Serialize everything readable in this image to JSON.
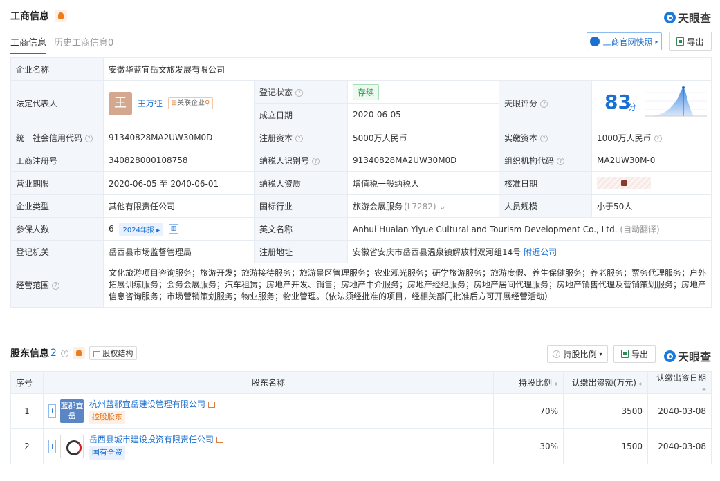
{
  "header": {
    "title": "工商信息",
    "tabs": [
      {
        "label": "工商信息"
      },
      {
        "label": "历史工商信息0"
      }
    ],
    "logo_text": "天眼查",
    "snapshot_btn": "工商官网快照",
    "export_btn": "导出"
  },
  "info": {
    "company_name_label": "企业名称",
    "company_name": "安徽华蓝宜岳文旅发展有限公司",
    "legal_rep_label": "法定代表人",
    "legal_rep_avatar": "王",
    "legal_rep_name": "王万征",
    "legal_rep_tag": "关联企业",
    "reg_status_label": "登记状态",
    "reg_status": "存续",
    "found_date_label": "成立日期",
    "found_date": "2020-06-05",
    "score_label": "天眼评分",
    "score": "83",
    "score_unit": "分",
    "credit_code_label": "统一社会信用代码",
    "credit_code": "91340828MA2UW30M0D",
    "reg_capital_label": "注册资本",
    "reg_capital": "5000万人民币",
    "paid_capital_label": "实缴资本",
    "paid_capital": "1000万人民币",
    "reg_no_label": "工商注册号",
    "reg_no": "340828000108758",
    "taxpayer_id_label": "纳税人识别号",
    "taxpayer_id": "91340828MA2UW30M0D",
    "org_code_label": "组织机构代码",
    "org_code": "MA2UW30M-0",
    "term_label": "营业期限",
    "term": "2020-06-05 至 2040-06-01",
    "taxpayer_qual_label": "纳税人资质",
    "taxpayer_qual": "增值税一般纳税人",
    "approve_date_label": "核准日期",
    "type_label": "企业类型",
    "type": "其他有限责任公司",
    "industry_label": "国标行业",
    "industry": "旅游会展服务",
    "industry_code": "(L7282)",
    "staff_label": "人员规模",
    "staff": "小于50人",
    "insured_label": "参保人数",
    "insured": "6",
    "insured_tag": "2024年报",
    "en_name_label": "英文名称",
    "en_name": "Anhui Hualan Yiyue Cultural and Tourism Development Co., Ltd.",
    "en_name_note": "(自动翻译)",
    "authority_label": "登记机关",
    "authority": "岳西县市场监督管理局",
    "address_label": "注册地址",
    "address": "安徽省安庆市岳西县温泉镇解放村双河组14号",
    "address_link": "附近公司",
    "scope_label": "经营范围",
    "scope": "文化旅游项目咨询服务；旅游开发；旅游接待服务；旅游景区管理服务；农业观光服务；研学旅游服务；旅游度假、养生保健服务；养老服务；票务代理服务；户外拓展训练服务；会务会展服务；汽车租赁；房地产开发、销售；房地产中介服务；房地产经纪服务；房地产居间代理服务；房地产销售代理及营销策划服务；房地产信息咨询服务；市场营销策划服务；物业服务；物业管理。（依法须经批准的项目，经相关部门批准后方可开展经营活动）"
  },
  "shareholders": {
    "title": "股东信息",
    "count": "2",
    "struct_btn": "股权结构",
    "ratio_btn": "持股比例",
    "export_btn": "导出",
    "logo_text": "天眼查",
    "columns": [
      "序号",
      "股东名称",
      "持股比例",
      "认缴出资额(万元)",
      "认缴出资日期"
    ],
    "rows": [
      {
        "no": "1",
        "logo": "蓝郡宜岳",
        "name": "杭州蓝郡宜岳建设管理有限公司",
        "tag": "控股股东",
        "ratio": "70%",
        "amount": "3500",
        "date": "2040-03-08"
      },
      {
        "no": "2",
        "logo": "",
        "name": "岳西县城市建设投资有限责任公司",
        "tag": "国有全资",
        "ratio": "30%",
        "amount": "1500",
        "date": "2040-03-08"
      }
    ]
  },
  "colors": {
    "accent": "#1a6fd0",
    "orange": "#e06c15",
    "green": "#1d9e43"
  }
}
